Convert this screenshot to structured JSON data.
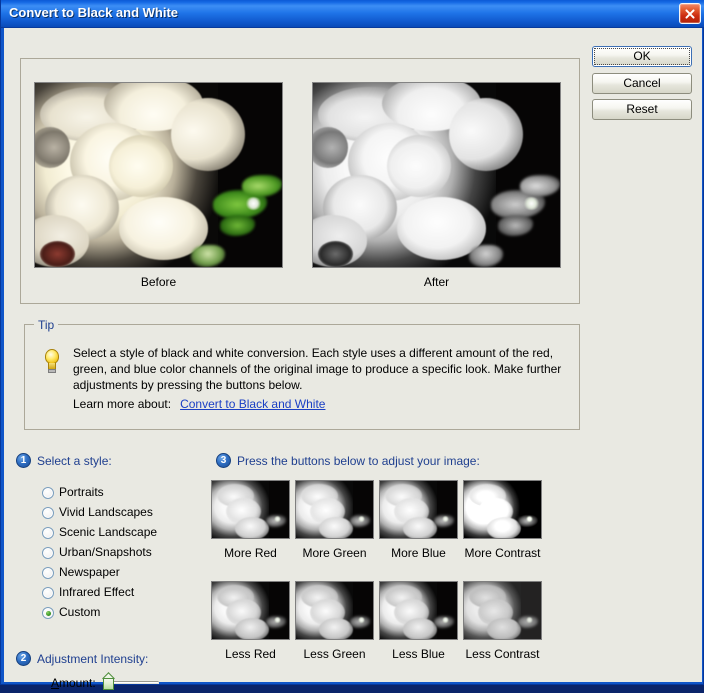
{
  "window": {
    "title": "Convert to Black and White",
    "close_icon": "close-icon"
  },
  "buttons": {
    "ok": "OK",
    "cancel": "Cancel",
    "reset": "Reset"
  },
  "preview": {
    "before_caption": "Before",
    "after_caption": "After"
  },
  "tip": {
    "legend": "Tip",
    "icon": "lightbulb-icon",
    "body": "Select a style of black and white conversion. Each style uses a different amount of the red, green, and blue color channels of the original image to produce a specific look. Make further adjustments by pressing the buttons below.",
    "learn_prefix": "Learn more about:",
    "learn_link": "Convert to Black and White"
  },
  "step1": {
    "number": "1",
    "label": "Select a style:",
    "options": [
      {
        "label": "Portraits",
        "checked": false
      },
      {
        "label": "Vivid Landscapes",
        "checked": false
      },
      {
        "label": "Scenic Landscape",
        "checked": false
      },
      {
        "label": "Urban/Snapshots",
        "checked": false
      },
      {
        "label": "Newspaper",
        "checked": false
      },
      {
        "label": "Infrared Effect",
        "checked": false
      },
      {
        "label": "Custom",
        "checked": true
      }
    ],
    "selected": "Custom"
  },
  "step2": {
    "number": "2",
    "label": "Adjustment Intensity:",
    "amount_label_prefix": "A",
    "amount_label_rest": "mount:",
    "amount_value": 12
  },
  "step3": {
    "number": "3",
    "label": "Press the buttons below to adjust your image:",
    "adjust_buttons": [
      {
        "label": "More Red"
      },
      {
        "label": "More Green"
      },
      {
        "label": "More Blue"
      },
      {
        "label": "More Contrast"
      },
      {
        "label": "Less Red"
      },
      {
        "label": "Less Green"
      },
      {
        "label": "Less Blue"
      },
      {
        "label": "Less Contrast"
      }
    ]
  },
  "colors": {
    "title_bar": "#1568e3",
    "dialog_face": "#e9e9e2",
    "legend_blue": "#1f3f8f",
    "link_blue": "#1a3fc4",
    "radio_dot_green": "#3f9a2a"
  }
}
